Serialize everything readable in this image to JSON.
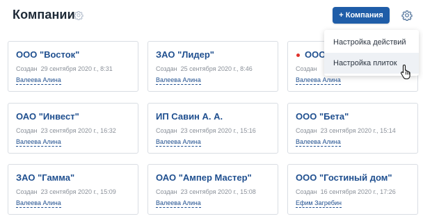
{
  "header": {
    "title": "Компании",
    "add_button_label": "+ Компания"
  },
  "dropdown": {
    "items": [
      {
        "label": "Настройка действий"
      },
      {
        "label": "Настройка плиток"
      }
    ]
  },
  "cards": [
    {
      "title": "ООО \"Восток\"",
      "created_label": "Создан",
      "created_date": "29 сентября 2020 г., 8:31",
      "user": "Валеева Алина",
      "flag": false
    },
    {
      "title": "ЗАО \"Лидер\"",
      "created_label": "Создан",
      "created_date": "25 сентября 2020 г., 8:46",
      "user": "Валеева Алина",
      "flag": false
    },
    {
      "title": "ООО",
      "created_label": "Создан",
      "created_date": "",
      "user": "Валеева Алина",
      "flag": true
    },
    {
      "title": "ОАО \"Инвест\"",
      "created_label": "Создан",
      "created_date": "23 сентября 2020 г., 16:32",
      "user": "Валеева Алина",
      "flag": false
    },
    {
      "title": "ИП Савин А. А.",
      "created_label": "Создан",
      "created_date": "23 сентября 2020 г., 15:16",
      "user": "Валеева Алина",
      "flag": false
    },
    {
      "title": "ООО \"Бета\"",
      "created_label": "Создан",
      "created_date": "23 сентября 2020 г., 15:14",
      "user": "Валеева Алина",
      "flag": false
    },
    {
      "title": "ЗАО \"Гамма\"",
      "created_label": "Создан",
      "created_date": "23 сентября 2020 г., 15:09",
      "user": "Валеева Алина",
      "flag": false
    },
    {
      "title": "ОАО \"Ампер Мастер\"",
      "created_label": "Создан",
      "created_date": "23 сентября 2020 г., 15:08",
      "user": "Валеева Алина",
      "flag": false
    },
    {
      "title": "ООО \"Гостиный дом\"",
      "created_label": "Создан",
      "created_date": "16 сентября 2020 г., 17:26",
      "user": "Ефим Загребин",
      "flag": false
    }
  ],
  "colors": {
    "accent": "#1f5da8",
    "link": "#1f4f8f",
    "flag": "#e0312b",
    "muted": "#8a9099"
  },
  "icons": {
    "title_settings": "gear-icon",
    "page_settings": "gear-icon",
    "cursor": "hand-pointer-icon"
  }
}
